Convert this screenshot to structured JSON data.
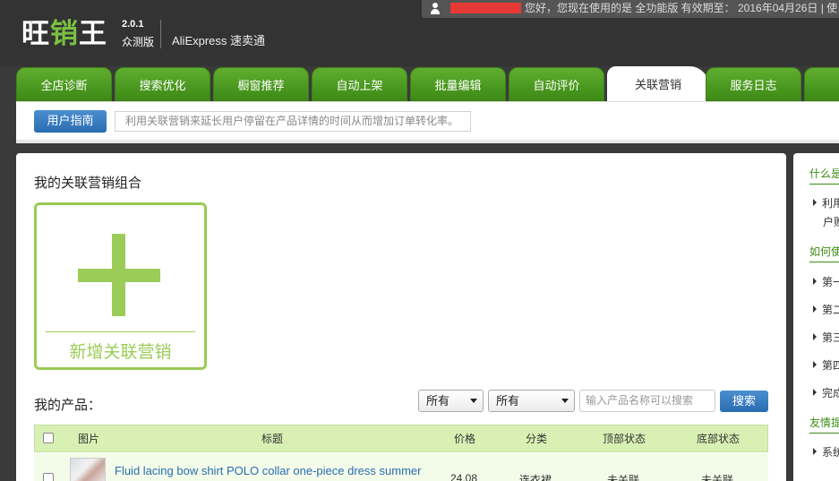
{
  "header": {
    "logo_text_part1": "旺",
    "logo_text_part2": "销",
    "logo_text_part3": "王",
    "version": "2.0.1",
    "beta": "众测版",
    "app_name": "AliExpress 速卖通",
    "brand_color": "#7ac143"
  },
  "userbar": {
    "message": "您好，您现在使用的是 全功能版  有效期至： 2016年04月26日  |  使"
  },
  "tabs": [
    {
      "label": "全店诊断"
    },
    {
      "label": "搜索优化"
    },
    {
      "label": "橱窗推荐"
    },
    {
      "label": "自动上架"
    },
    {
      "label": "批量编辑"
    },
    {
      "label": "自动评价"
    },
    {
      "label": "关联营销",
      "active": true
    },
    {
      "label": "服务日志"
    }
  ],
  "guide": {
    "button": "用户指南",
    "text": "利用关联营销来延长用户停留在产品详情的时间从而增加订单转化率。"
  },
  "main": {
    "section_title": "我的关联营销组合",
    "add_label": "新增关联营销",
    "products_title": "我的产品：",
    "filter1": "所有",
    "filter2": "所有",
    "search_placeholder": "输入产品名称可以搜索",
    "search_button": "搜索"
  },
  "table": {
    "headers": [
      "图片",
      "标题",
      "价格",
      "分类",
      "顶部状态",
      "底部状态"
    ],
    "rows": [
      {
        "title": "Fluid lacing bow shirt POLO collar one-piece dress summer",
        "price": "24.08",
        "category": "连衣裙",
        "top_status": "未关联",
        "bottom_status": "未关联"
      }
    ]
  },
  "sidebar": {
    "h1": "什么是",
    "item1": "利用",
    "item1_sub": "户赠",
    "h2": "如何使",
    "steps": [
      "第一",
      "第二",
      "第三",
      "第四",
      "完成"
    ],
    "h3": "友情提",
    "item3": "系统"
  }
}
